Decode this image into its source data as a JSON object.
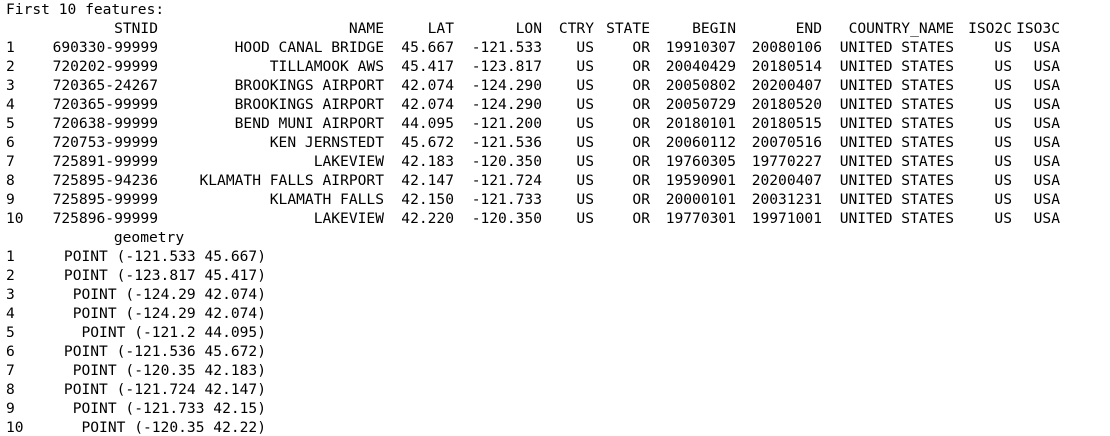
{
  "heading": "First 10 features:",
  "columns": {
    "stnid": "STNID",
    "name": "NAME",
    "lat": "LAT",
    "lon": "LON",
    "ctry": "CTRY",
    "state": "STATE",
    "begin": "BEGIN",
    "end": "END",
    "country_name": "COUNTRY_NAME",
    "iso2c": "ISO2C",
    "iso3c": "ISO3C"
  },
  "rows": [
    {
      "idx": "1",
      "stnid": "690330-99999",
      "name": "HOOD CANAL BRIDGE",
      "lat": "45.667",
      "lon": "-121.533",
      "ctry": "US",
      "state": "OR",
      "begin": "19910307",
      "end": "20080106",
      "country_name": "UNITED STATES",
      "iso2c": "US",
      "iso3c": "USA"
    },
    {
      "idx": "2",
      "stnid": "720202-99999",
      "name": "TILLAMOOK AWS",
      "lat": "45.417",
      "lon": "-123.817",
      "ctry": "US",
      "state": "OR",
      "begin": "20040429",
      "end": "20180514",
      "country_name": "UNITED STATES",
      "iso2c": "US",
      "iso3c": "USA"
    },
    {
      "idx": "3",
      "stnid": "720365-24267",
      "name": "BROOKINGS AIRPORT",
      "lat": "42.074",
      "lon": "-124.290",
      "ctry": "US",
      "state": "OR",
      "begin": "20050802",
      "end": "20200407",
      "country_name": "UNITED STATES",
      "iso2c": "US",
      "iso3c": "USA"
    },
    {
      "idx": "4",
      "stnid": "720365-99999",
      "name": "BROOKINGS AIRPORT",
      "lat": "42.074",
      "lon": "-124.290",
      "ctry": "US",
      "state": "OR",
      "begin": "20050729",
      "end": "20180520",
      "country_name": "UNITED STATES",
      "iso2c": "US",
      "iso3c": "USA"
    },
    {
      "idx": "5",
      "stnid": "720638-99999",
      "name": "BEND MUNI AIRPORT",
      "lat": "44.095",
      "lon": "-121.200",
      "ctry": "US",
      "state": "OR",
      "begin": "20180101",
      "end": "20180515",
      "country_name": "UNITED STATES",
      "iso2c": "US",
      "iso3c": "USA"
    },
    {
      "idx": "6",
      "stnid": "720753-99999",
      "name": "KEN JERNSTEDT",
      "lat": "45.672",
      "lon": "-121.536",
      "ctry": "US",
      "state": "OR",
      "begin": "20060112",
      "end": "20070516",
      "country_name": "UNITED STATES",
      "iso2c": "US",
      "iso3c": "USA"
    },
    {
      "idx": "7",
      "stnid": "725891-99999",
      "name": "LAKEVIEW",
      "lat": "42.183",
      "lon": "-120.350",
      "ctry": "US",
      "state": "OR",
      "begin": "19760305",
      "end": "19770227",
      "country_name": "UNITED STATES",
      "iso2c": "US",
      "iso3c": "USA"
    },
    {
      "idx": "8",
      "stnid": "725895-94236",
      "name": "KLAMATH FALLS AIRPORT",
      "lat": "42.147",
      "lon": "-121.724",
      "ctry": "US",
      "state": "OR",
      "begin": "19590901",
      "end": "20200407",
      "country_name": "UNITED STATES",
      "iso2c": "US",
      "iso3c": "USA"
    },
    {
      "idx": "9",
      "stnid": "725895-99999",
      "name": "KLAMATH FALLS",
      "lat": "42.150",
      "lon": "-121.733",
      "ctry": "US",
      "state": "OR",
      "begin": "20000101",
      "end": "20031231",
      "country_name": "UNITED STATES",
      "iso2c": "US",
      "iso3c": "USA"
    },
    {
      "idx": "10",
      "stnid": "725896-99999",
      "name": "LAKEVIEW",
      "lat": "42.220",
      "lon": "-120.350",
      "ctry": "US",
      "state": "OR",
      "begin": "19770301",
      "end": "19971001",
      "country_name": "UNITED STATES",
      "iso2c": "US",
      "iso3c": "USA"
    }
  ],
  "geometry_header": "geometry",
  "geometry": [
    {
      "idx": "1",
      "value": "POINT (-121.533 45.667)"
    },
    {
      "idx": "2",
      "value": "POINT (-123.817 45.417)"
    },
    {
      "idx": "3",
      "value": "POINT (-124.29 42.074)"
    },
    {
      "idx": "4",
      "value": "POINT (-124.29 42.074)"
    },
    {
      "idx": "5",
      "value": "POINT (-121.2 44.095)"
    },
    {
      "idx": "6",
      "value": "POINT (-121.536 45.672)"
    },
    {
      "idx": "7",
      "value": "POINT (-120.35 42.183)"
    },
    {
      "idx": "8",
      "value": "POINT (-121.724 42.147)"
    },
    {
      "idx": "9",
      "value": "POINT (-121.733 42.15)"
    },
    {
      "idx": "10",
      "value": "POINT (-120.35 42.22)"
    }
  ]
}
